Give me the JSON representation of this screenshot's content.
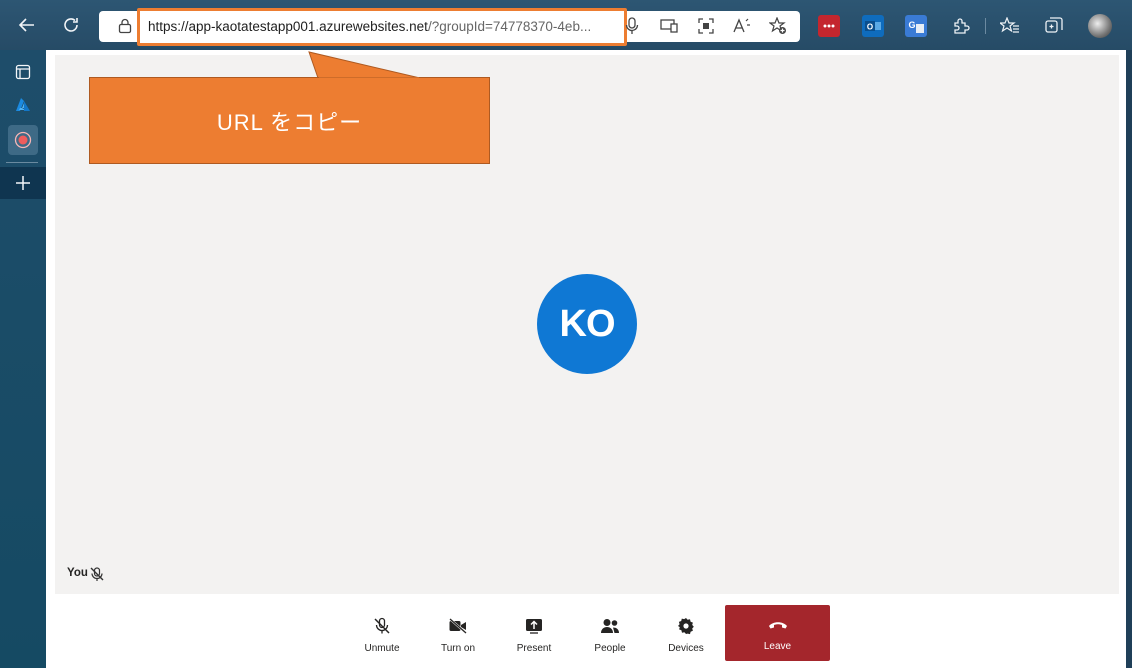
{
  "browser": {
    "url_host": "https://app-kaotatestapp001.azurewebsites.net",
    "url_rest": "/?groupId=74778370-4eb..."
  },
  "callout": {
    "text": "URL をコピー"
  },
  "meeting": {
    "avatar_initials": "KO",
    "self_label": "You"
  },
  "controls": {
    "unmute": "Unmute",
    "turn_on": "Turn on",
    "present": "Present",
    "people": "People",
    "devices": "Devices",
    "leave": "Leave"
  },
  "colors": {
    "accent": "#ed7d31",
    "avatar": "#0f78d4",
    "leave": "#a4262c"
  }
}
